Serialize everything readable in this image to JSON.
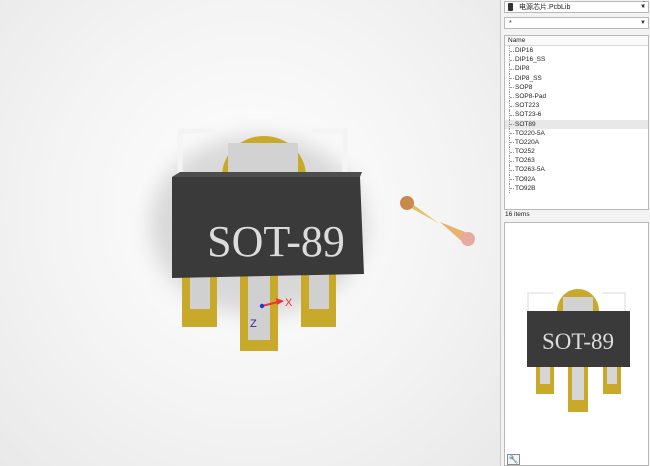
{
  "viewport": {
    "component_label": "SOT-89",
    "axis_x_label": "X",
    "axis_z_label": "Z"
  },
  "panel": {
    "library_name": "电源芯片.PcbLib",
    "filter_value": "*",
    "column_name": "Name",
    "items": [
      {
        "label": "DIP16"
      },
      {
        "label": "DIP16_SS"
      },
      {
        "label": "DIP8"
      },
      {
        "label": "DIP8_SS"
      },
      {
        "label": "SOP8"
      },
      {
        "label": "SOP8-Pad"
      },
      {
        "label": "SOT223"
      },
      {
        "label": "SOT23-6"
      },
      {
        "label": "SOT89",
        "selected": true
      },
      {
        "label": "TO220-5A"
      },
      {
        "label": "TO220A"
      },
      {
        "label": "TO252"
      },
      {
        "label": "TO263"
      },
      {
        "label": "TO263-5A"
      },
      {
        "label": "TO92A"
      },
      {
        "label": "TO92B"
      }
    ],
    "item_count": "16 items",
    "preview_label": "SOT-89"
  },
  "icons": {
    "library": "book-icon",
    "dropdown": "chevron-down-icon",
    "more": "more-dots-icon",
    "tool": "wrench-icon"
  },
  "colors": {
    "body": "#3a3a3a",
    "pad_gold": "#c9a92a",
    "pad_silver": "#cfcfcf",
    "silkscreen": "#f2f2f2",
    "label_text": "#d8d8d8"
  }
}
